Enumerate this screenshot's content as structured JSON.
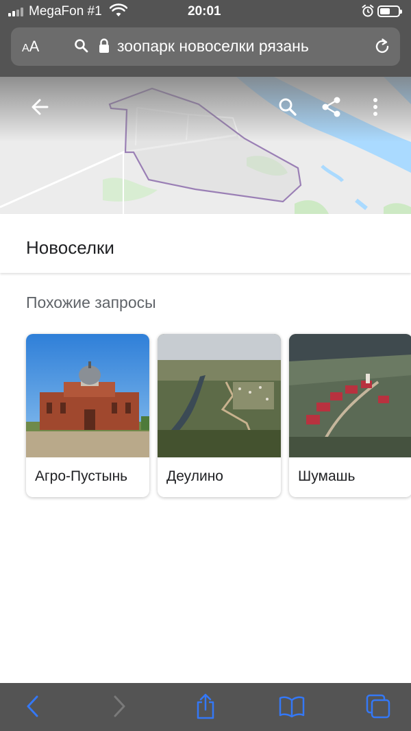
{
  "status_bar": {
    "carrier": "MegaFon #1",
    "time": "20:01",
    "signal_icon": "cellular-signal-icon",
    "wifi_icon": "wifi-icon",
    "alarm_icon": "alarm-clock-icon",
    "battery_icon": "battery-icon",
    "battery_level": 0.55
  },
  "address_bar": {
    "text_size_label": "AA",
    "url_text": "зоопарк новоселки рязань",
    "search_icon": "search-icon",
    "lock_icon": "lock-icon",
    "reload_icon": "reload-icon"
  },
  "map": {
    "back_icon": "back-arrow-icon",
    "search_icon": "search-icon",
    "share_icon": "share-icon",
    "more_icon": "more-vert-icon",
    "boundary_color": "#9a7fb5",
    "water_color": "#aadaff"
  },
  "place": {
    "title": "Новоселки"
  },
  "related": {
    "title": "Похожие запросы",
    "items": [
      {
        "label": "Агро-Пустынь"
      },
      {
        "label": "Деулино"
      },
      {
        "label": "Шумашь"
      }
    ]
  },
  "toolbar": {
    "back_icon": "chevron-left-icon",
    "forward_icon": "chevron-right-icon",
    "share_icon": "share-icon",
    "bookmarks_icon": "book-icon",
    "tabs_icon": "tabs-icon",
    "accent_color": "#3478f6"
  }
}
